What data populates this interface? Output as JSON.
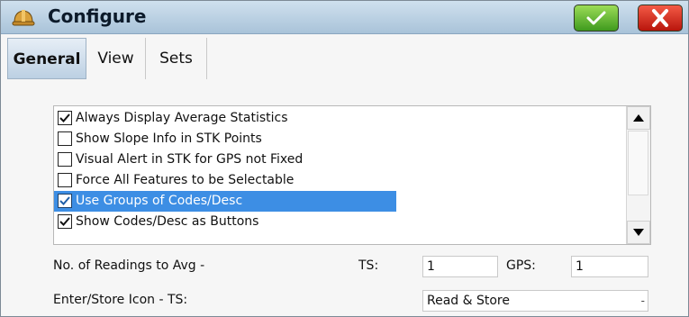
{
  "window": {
    "title": "Configure",
    "icon": "hard-hat-icon",
    "ok_icon": "checkmark-icon",
    "cancel_icon": "close-x-icon",
    "colors": {
      "ok": "#4caf2a",
      "cancel": "#d8261a",
      "accent": "#3d8ee4"
    }
  },
  "tabs": [
    {
      "label": "General",
      "active": true
    },
    {
      "label": "View",
      "active": false
    },
    {
      "label": "Sets",
      "active": false
    }
  ],
  "options": [
    {
      "label": "Always Display Average Statistics",
      "checked": true,
      "selected": false
    },
    {
      "label": "Show Slope Info in STK Points",
      "checked": false,
      "selected": false
    },
    {
      "label": "Visual Alert in STK for GPS not Fixed",
      "checked": false,
      "selected": false
    },
    {
      "label": "Force All Features to be Selectable",
      "checked": false,
      "selected": false
    },
    {
      "label": "Use Groups of Codes/Desc",
      "checked": true,
      "selected": true
    },
    {
      "label": "Show Codes/Desc as Buttons",
      "checked": true,
      "selected": false
    }
  ],
  "readings": {
    "label": "No. of Readings to Avg  -",
    "ts_label": "TS:",
    "ts_value": "1",
    "gps_label": "GPS:",
    "gps_value": "1"
  },
  "enter_store": {
    "label": "Enter/Store Icon - TS:",
    "value": "Read & Store"
  }
}
